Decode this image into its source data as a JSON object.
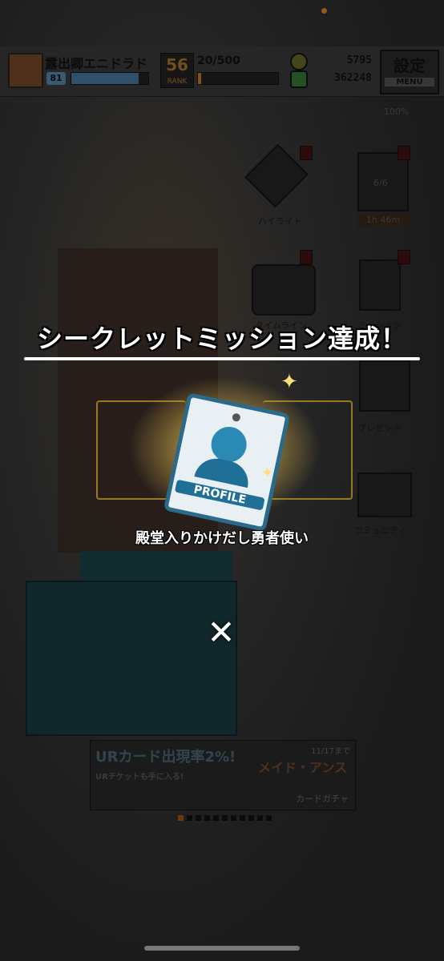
{
  "player": {
    "name": "露出卿エニドラド",
    "level_badge": "81",
    "rank": "56",
    "rank_label": "RANK",
    "stamina": "20/500"
  },
  "currency": {
    "coins": "5795",
    "gems": "362248"
  },
  "menu": {
    "label": "設定",
    "sub": "MENU"
  },
  "status": {
    "battery": "100%"
  },
  "side_menu": [
    {
      "label": "ハイライト"
    },
    {
      "label": "6/6"
    },
    {
      "label": "1h 46m"
    },
    {
      "label": "タイムライン"
    },
    {
      "label": "ミッション"
    },
    {
      "label": "プレゼント"
    },
    {
      "label": "コミュニティ"
    }
  ],
  "banner": {
    "left_title": "URカード出現率2%!",
    "left_sub": "URチケットも手に入る!",
    "date": "11/17まで",
    "right_title": "メイド・アンス",
    "right_sub": "カードガチャ"
  },
  "dialog": {
    "headline": "シークレットミッション達成！",
    "reward_tag": "PROFILE",
    "reward_name": "殿堂入りかけだし勇者使い",
    "close_glyph": "✕"
  },
  "colors": {
    "accent": "#e58a2a",
    "tag_blue": "#2a6a8a"
  }
}
